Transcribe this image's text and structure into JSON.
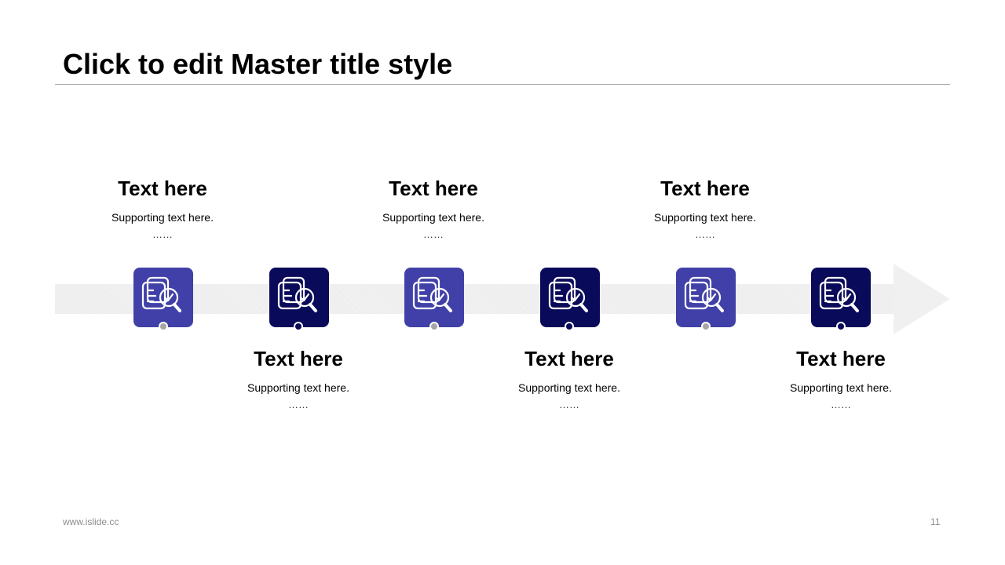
{
  "title": "Click to edit Master title style",
  "colors": {
    "light_purple": "#4040a8",
    "dark_navy": "#0a0a5a",
    "dot_gray": "#a6a6a6",
    "arrow_gray": "#f2f2f2"
  },
  "steps": [
    {
      "heading": "Text here",
      "supporting": "Supporting text here.",
      "ellipsis": "……",
      "icon": "document-search-check-icon",
      "style": "light",
      "text_position": "above"
    },
    {
      "heading": "Text here",
      "supporting": "Supporting text here.",
      "ellipsis": "……",
      "icon": "document-search-check-icon",
      "style": "dark",
      "text_position": "below"
    },
    {
      "heading": "Text here",
      "supporting": "Supporting text here.",
      "ellipsis": "……",
      "icon": "document-search-check-icon",
      "style": "light",
      "text_position": "above"
    },
    {
      "heading": "Text here",
      "supporting": "Supporting text here.",
      "ellipsis": "……",
      "icon": "document-search-check-icon",
      "style": "dark",
      "text_position": "below"
    },
    {
      "heading": "Text here",
      "supporting": "Supporting text here.",
      "ellipsis": "……",
      "icon": "document-search-check-icon",
      "style": "light",
      "text_position": "above"
    },
    {
      "heading": "Text here",
      "supporting": "Supporting text here.",
      "ellipsis": "……",
      "icon": "document-search-check-icon",
      "style": "dark",
      "text_position": "below"
    }
  ],
  "footer": {
    "url": "www.islide.cc",
    "page_number": "11"
  }
}
